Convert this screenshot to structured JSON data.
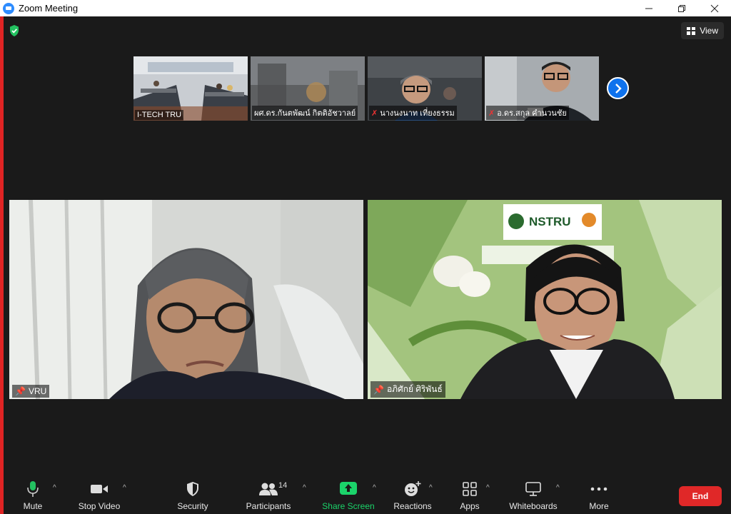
{
  "window": {
    "title": "Zoom Meeting"
  },
  "meeting": {
    "view_label": "View"
  },
  "thumbnails": [
    {
      "name": "I-TECH TRU",
      "muted": false
    },
    {
      "name": "ผศ.ดร.กันตพัฒน์ กิตติอัชวาลย์",
      "muted": false
    },
    {
      "name": "นางนงนาท เที่ยงธรรม",
      "muted": true
    },
    {
      "name": "อ.ดร.สกุล คำนวนชัย",
      "muted": true
    }
  ],
  "main_tiles": [
    {
      "name": "VRU"
    },
    {
      "name": "อภิศักย์ ศิริพันธ์",
      "banner": "NSTRU"
    }
  ],
  "toolbar": {
    "mute": "Mute",
    "stop_video": "Stop Video",
    "security": "Security",
    "participants": "Participants",
    "participants_count": "14",
    "share_screen": "Share Screen",
    "reactions": "Reactions",
    "apps": "Apps",
    "whiteboards": "Whiteboards",
    "more": "More",
    "end": "End"
  },
  "colors": {
    "accent": "#0e72ed",
    "share": "#1bd36a",
    "end": "#e02828",
    "edge": "#e02424"
  }
}
